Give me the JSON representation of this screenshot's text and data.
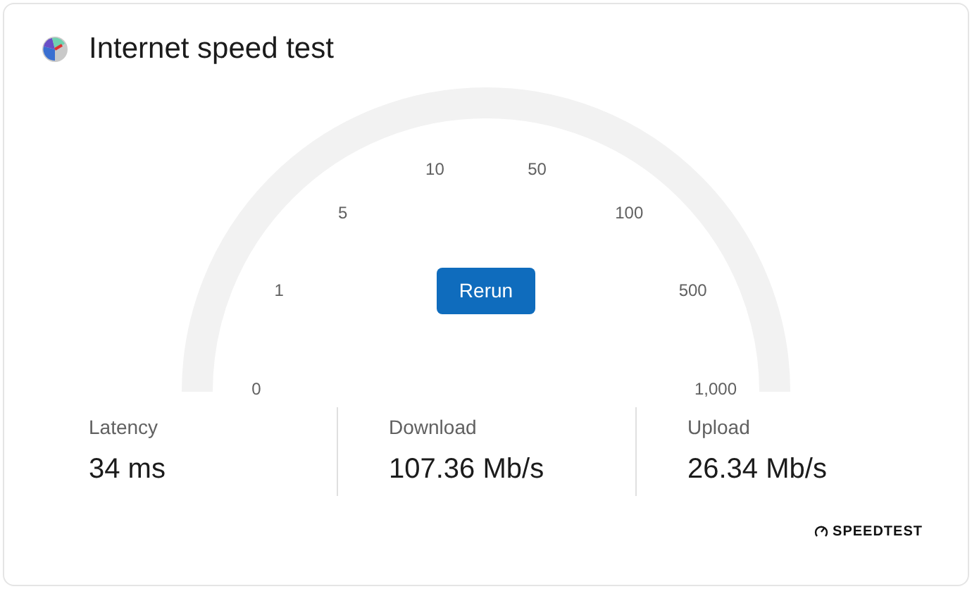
{
  "title": "Internet speed test",
  "gauge": {
    "ticks": [
      "0",
      "1",
      "5",
      "10",
      "50",
      "100",
      "500",
      "1,000"
    ],
    "button": "Rerun"
  },
  "stats": [
    {
      "label": "Latency",
      "value": "34 ms"
    },
    {
      "label": "Download",
      "value": "107.36 Mb/s"
    },
    {
      "label": "Upload",
      "value": "26.34 Mb/s"
    }
  ],
  "brand": "SPEEDTEST"
}
